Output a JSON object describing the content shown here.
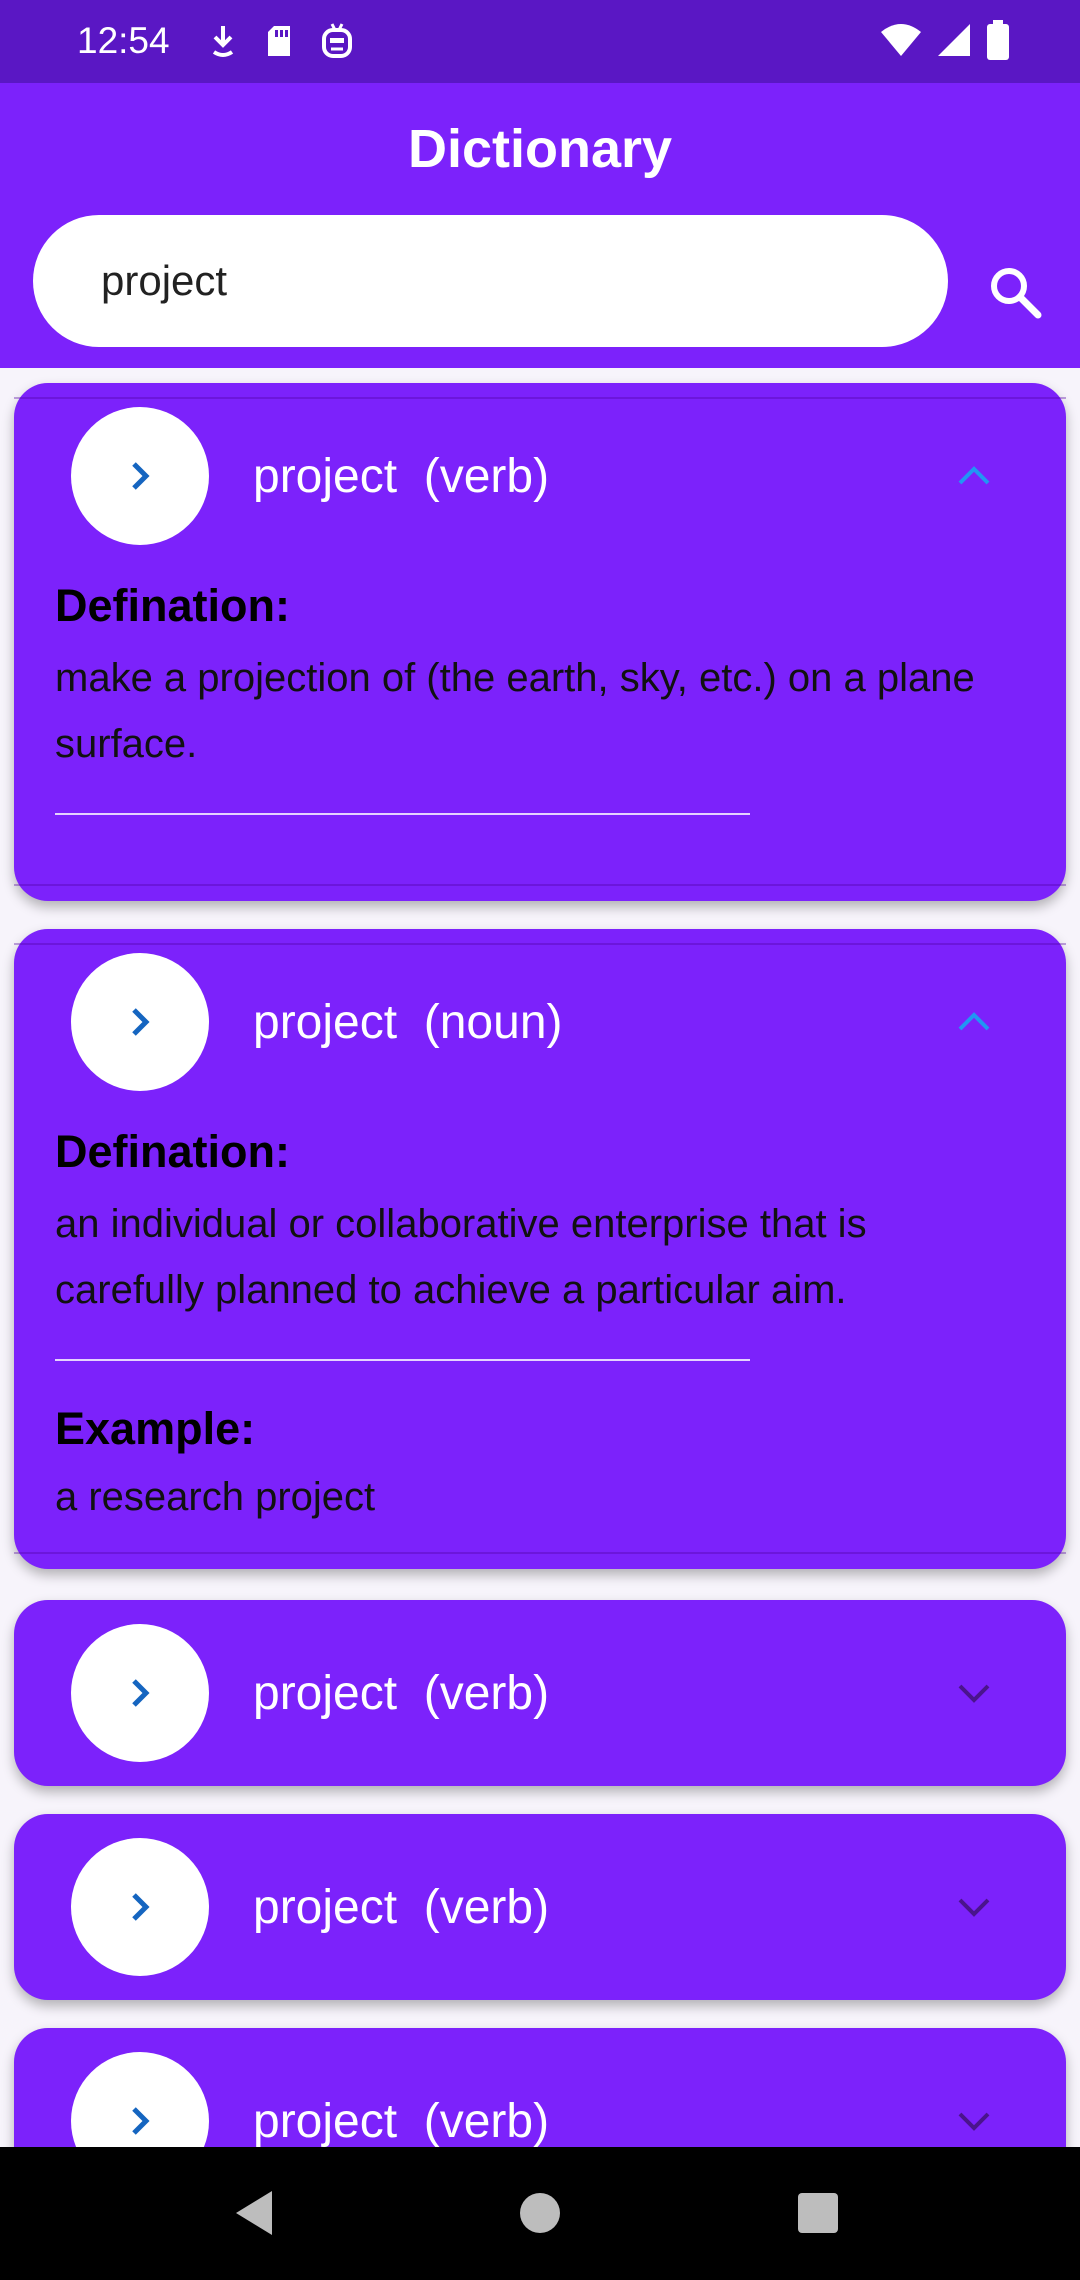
{
  "status": {
    "time": "12:54",
    "left_icons": [
      "download-icon",
      "sd-card-icon",
      "robot-face-icon"
    ],
    "right_icons": [
      "wifi-icon",
      "signal-icon",
      "battery-icon"
    ]
  },
  "app": {
    "title": "Dictionary"
  },
  "search": {
    "value": "project",
    "icon": "search-icon"
  },
  "entries": [
    {
      "word": "project",
      "pos": "(verb)",
      "expanded": true,
      "definition_label": "Defination:",
      "definition": "make a projection of (the earth, sky, etc.) on a plane surface."
    },
    {
      "word": "project",
      "pos": "(noun)",
      "expanded": true,
      "definition_label": "Defination:",
      "definition": "an individual or collaborative enterprise that is carefully planned to achieve a particular aim.",
      "example_label": "Example:",
      "example": "a research project"
    },
    {
      "word": "project",
      "pos": "(verb)",
      "expanded": false
    },
    {
      "word": "project",
      "pos": "(verb)",
      "expanded": false
    },
    {
      "word": "project",
      "pos": "(verb)",
      "expanded": false
    }
  ],
  "colors": {
    "status_bar": "#5a17c4",
    "primary": "#7c22fb",
    "avatar_chevron": "#1565c0",
    "expanded_chevron": "#2196f3",
    "collapsed_chevron": "#4a148c"
  },
  "nav": {
    "buttons": [
      "back-icon",
      "home-icon",
      "recents-icon"
    ]
  }
}
